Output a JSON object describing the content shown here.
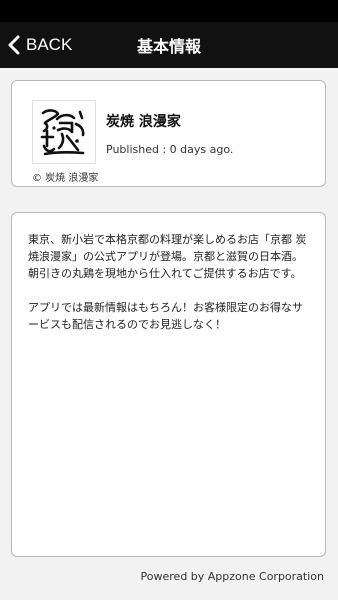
{
  "nav": {
    "back_label": "BACK",
    "title": "基本情報"
  },
  "profile": {
    "shop_name": "炭焼 浪漫家",
    "published": "Published : 0 days ago.",
    "copyright": "© 炭焼 浪漫家",
    "logo_icon": "roman-calligraphy-logo"
  },
  "description": {
    "paragraph1": "東京、新小岩で本格京都の料理が楽しめるお店「京都 炭焼浪漫家」の公式アプリが登場。京都と滋賀の日本酒。朝引きの丸鶏を現地から仕入れてご提供するお店です。",
    "paragraph2": "アプリでは最新情報はもちろん！お客様限定のお得なサービスも配信されるのでお見逃しなく！"
  },
  "footer": {
    "powered_by": "Powered by Appzone Corporation"
  }
}
